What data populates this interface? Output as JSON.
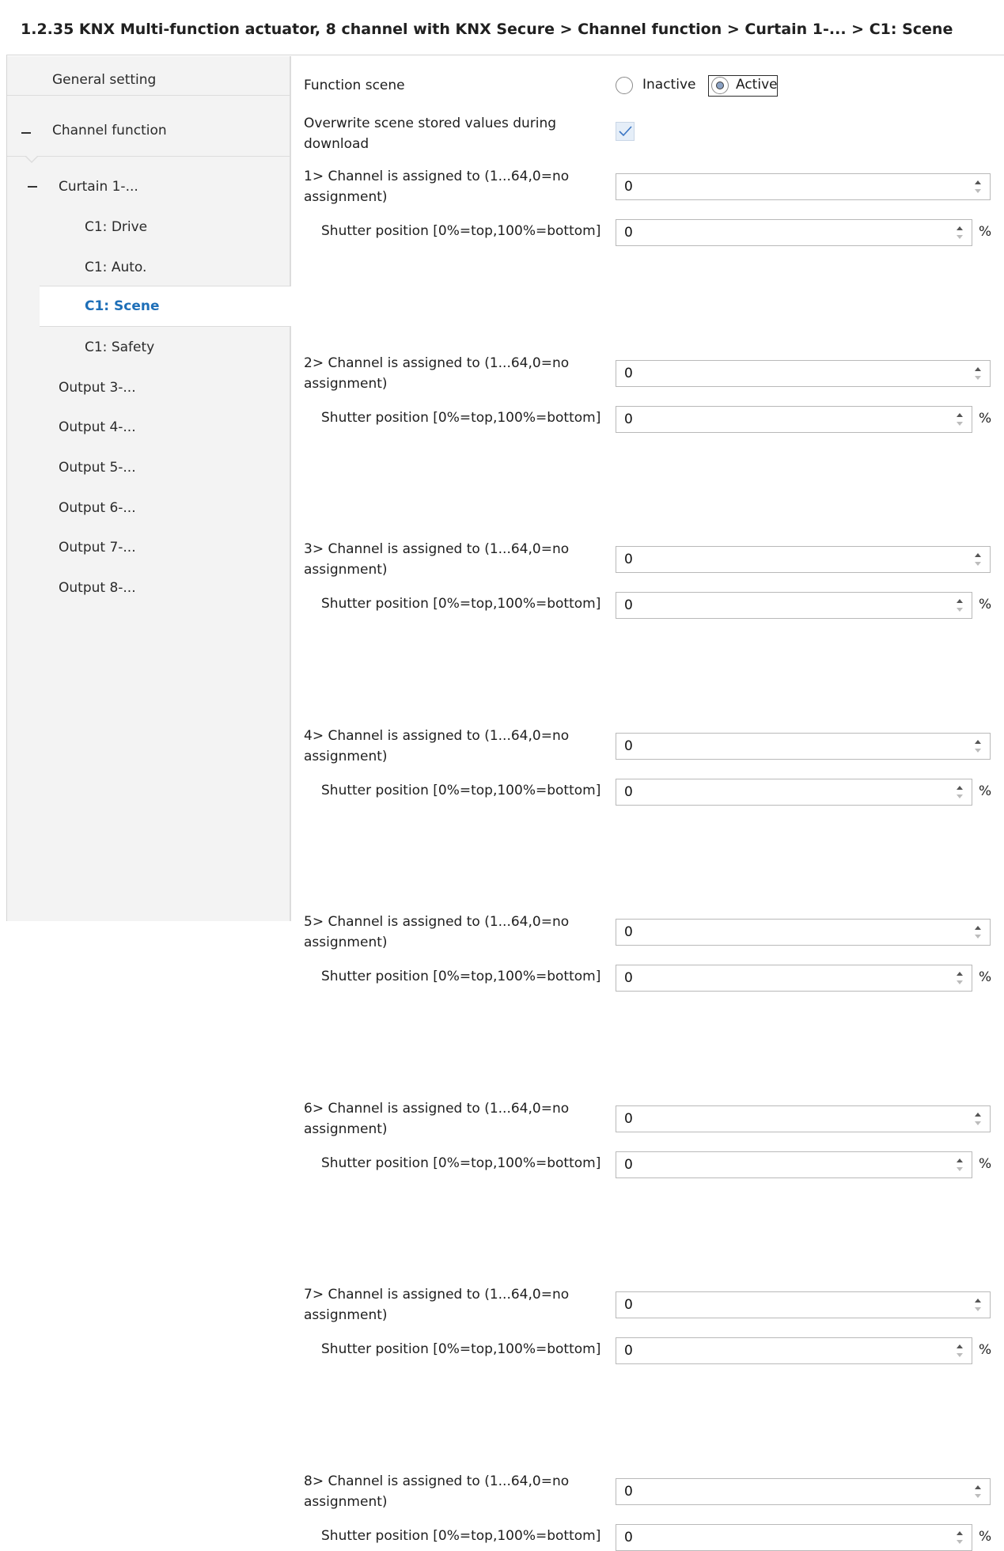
{
  "breadcrumb": "1.2.35 KNX Multi-function actuator, 8 channel with KNX Secure > Channel function > Curtain 1-... > C1: Scene",
  "sidebar": {
    "items": [
      {
        "label": "General setting"
      },
      {
        "label": "Channel function",
        "expanded": true
      },
      {
        "label": "Curtain 1-...",
        "expanded": true
      },
      {
        "label": "C1: Drive"
      },
      {
        "label": "C1: Auto."
      },
      {
        "label": "C1: Scene",
        "selected": true
      },
      {
        "label": "C1: Safety"
      },
      {
        "label": "Output 3-..."
      },
      {
        "label": "Output 4-..."
      },
      {
        "label": "Output 5-..."
      },
      {
        "label": "Output 6-..."
      },
      {
        "label": "Output 7-..."
      },
      {
        "label": "Output 8-..."
      }
    ]
  },
  "main": {
    "function_scene": {
      "label": "Function scene",
      "options": [
        "Inactive",
        "Active"
      ],
      "selected": "Active"
    },
    "overwrite": {
      "label": "Overwrite scene stored values during download",
      "checked": true
    },
    "channels": [
      {
        "assign_label": "1> Channel is assigned to (1...64,0=no assignment)",
        "assign_value": "0",
        "position_label": "Shutter position [0%=top,100%=bottom]",
        "position_value": "0",
        "unit": "%"
      },
      {
        "assign_label": "2> Channel is assigned to (1...64,0=no assignment)",
        "assign_value": "0",
        "position_label": "Shutter position [0%=top,100%=bottom]",
        "position_value": "0",
        "unit": "%"
      },
      {
        "assign_label": "3> Channel is assigned to (1...64,0=no assignment)",
        "assign_value": "0",
        "position_label": "Shutter position [0%=top,100%=bottom]",
        "position_value": "0",
        "unit": "%"
      },
      {
        "assign_label": "4> Channel is assigned to (1...64,0=no assignment)",
        "assign_value": "0",
        "position_label": "Shutter position [0%=top,100%=bottom]",
        "position_value": "0",
        "unit": "%"
      },
      {
        "assign_label": "5> Channel is assigned to (1...64,0=no assignment)",
        "assign_value": "0",
        "position_label": "Shutter position [0%=top,100%=bottom]",
        "position_value": "0",
        "unit": "%"
      },
      {
        "assign_label": "6> Channel is assigned to (1...64,0=no assignment)",
        "assign_value": "0",
        "position_label": "Shutter position [0%=top,100%=bottom]",
        "position_value": "0",
        "unit": "%"
      },
      {
        "assign_label": "7> Channel is assigned to (1...64,0=no assignment)",
        "assign_value": "0",
        "position_label": "Shutter position [0%=top,100%=bottom]",
        "position_value": "0",
        "unit": "%"
      },
      {
        "assign_label": "8> Channel is assigned to (1...64,0=no assignment)",
        "assign_value": "0",
        "position_label": "Shutter position [0%=top,100%=bottom]",
        "position_value": "0",
        "unit": "%"
      }
    ]
  }
}
